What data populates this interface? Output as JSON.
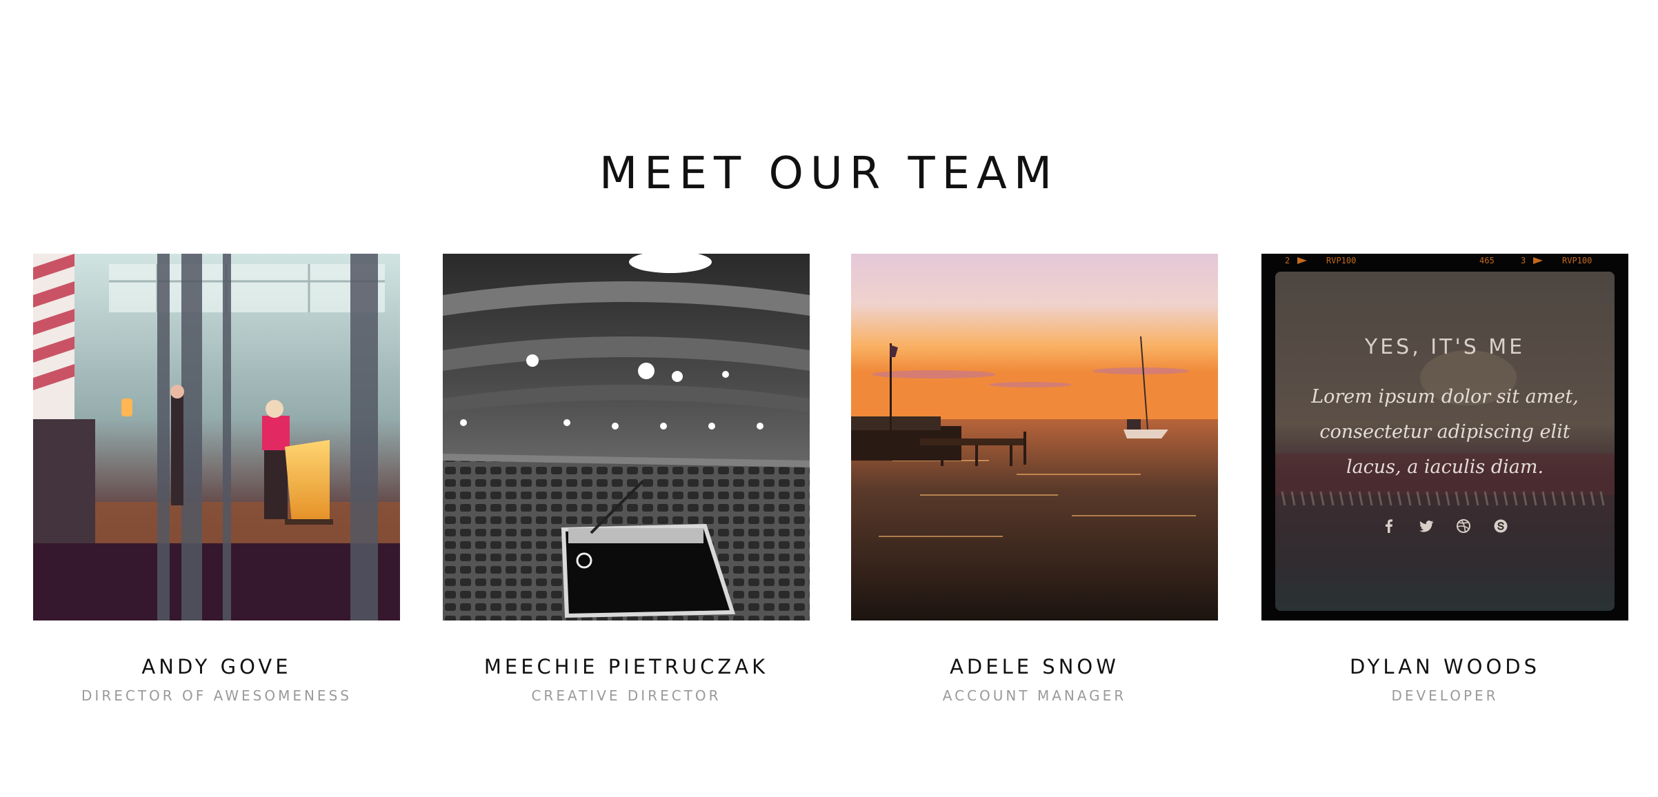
{
  "section": {
    "title": "MEET OUR TEAM"
  },
  "team": [
    {
      "name": "ANDY GOVE",
      "role": "DIRECTOR OF AWESOMENESS",
      "photo_subject": "speaker-at-podium-photo"
    },
    {
      "name": "MEECHIE PIETRUCZAK",
      "role": "CREATIVE DIRECTOR",
      "photo_subject": "empty-theater-photo"
    },
    {
      "name": "ADELE SNOW",
      "role": "ACCOUNT MANAGER",
      "photo_subject": "sunset-lake-photo"
    },
    {
      "name": "DYLAN WOODS",
      "role": "DEVELOPER",
      "photo_subject": "film-frame-photo",
      "overlay": {
        "title": "YES, IT'S ME",
        "text": "Lorem ipsum dolor sit amet, consectetur adipiscing elit lacus, a iaculis diam.",
        "film_labels": [
          "2",
          "RVP100",
          "465",
          "3",
          "RVP100"
        ],
        "socials": [
          "facebook-icon",
          "twitter-icon",
          "dribbble-icon",
          "skype-icon"
        ]
      }
    }
  ],
  "colors": {
    "title": "#111111",
    "role": "#9a9a9a",
    "background": "#ffffff"
  }
}
